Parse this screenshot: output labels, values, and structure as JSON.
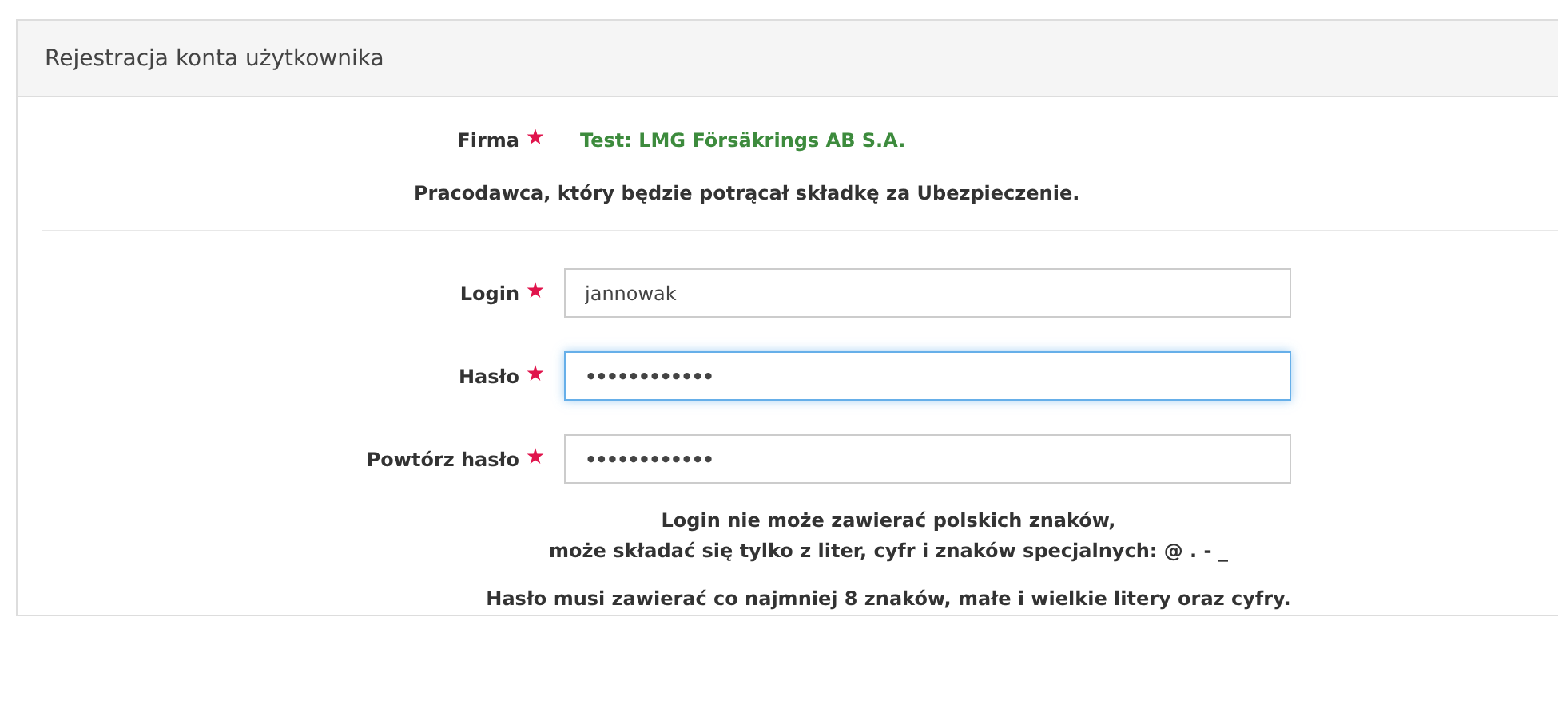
{
  "panel": {
    "title": "Rejestracja konta użytkownika"
  },
  "company": {
    "label": "Firma",
    "required": true,
    "value": "Test: LMG Försäkrings AB S.A."
  },
  "company_note": "Pracodawca, który będzie potrącał składkę za Ubezpieczenie.",
  "fields": [
    {
      "label": "Login",
      "required": true,
      "value": "jannowak",
      "focused": false,
      "kind": "text"
    },
    {
      "label": "Hasło",
      "required": true,
      "value": "••••••••••••",
      "focused": true,
      "kind": "password"
    },
    {
      "label": "Powtórz hasło",
      "required": true,
      "value": "••••••••••••",
      "focused": false,
      "kind": "password"
    }
  ],
  "notes": [
    "Login nie może zawierać polskich znaków,",
    "może składać się tylko z liter, cyfr i znaków specjalnych: @ . - _",
    "Hasło musi zawierać co najmniej 8 znaków, małe i wielkie litery oraz cyfry."
  ]
}
